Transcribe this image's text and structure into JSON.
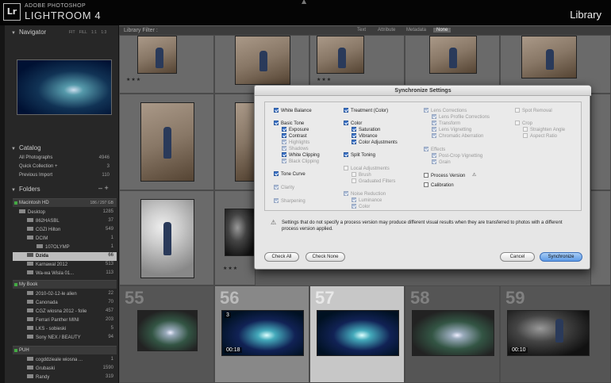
{
  "app": {
    "logo": "Lr",
    "brand_top": "ADOBE PHOTOSHOP",
    "brand_name": "LIGHTROOM 4",
    "module": "Library"
  },
  "left_panel": {
    "navigator": {
      "title": "Navigator",
      "options": "FIT FILL 1:1 1:3"
    },
    "catalog": {
      "title": "Catalog",
      "items": [
        {
          "label": "All Photographs",
          "count": "4946"
        },
        {
          "label": "Quick Collection +",
          "count": "3"
        },
        {
          "label": "Previous Import",
          "count": "110"
        }
      ]
    },
    "folders": {
      "title": "Folders",
      "controls": "– +",
      "drives": [
        {
          "label": "Macintosh HD",
          "info": "186 / 297 GB"
        },
        {
          "label": "My Book",
          "info": ""
        },
        {
          "label": "PUH",
          "info": ""
        }
      ],
      "mac_items": [
        {
          "label": "Desktop",
          "count": "1285"
        },
        {
          "label": "862HASBL",
          "count": "37"
        },
        {
          "label": "CGZI Hilton",
          "count": "549"
        },
        {
          "label": "DCIM",
          "count": "1"
        },
        {
          "label": "107OLYMP",
          "count": "1"
        },
        {
          "label": "Dzida",
          "count": "66"
        },
        {
          "label": "Karnawal 2012",
          "count": "513"
        },
        {
          "label": "Wa-wa Wisla 01...",
          "count": "113"
        }
      ],
      "mybook_items": [
        {
          "label": "2010-02-12-le alien",
          "count": "22"
        },
        {
          "label": "Canonada",
          "count": "70"
        },
        {
          "label": "CGZ wiosna 2012 - folie",
          "count": "457"
        },
        {
          "label": "Ferrari Panther MINI",
          "count": "203"
        },
        {
          "label": "LKS - sobieski",
          "count": "5"
        },
        {
          "label": "Sony NEX / BEAUTY",
          "count": "94"
        }
      ],
      "puh_items": [
        {
          "label": "cogddzieale wiosna ...",
          "count": "1"
        },
        {
          "label": "Grubaski",
          "count": "1590"
        },
        {
          "label": "Randy",
          "count": "319"
        }
      ]
    }
  },
  "filter_bar": {
    "label": "Library Filter :",
    "options": [
      "Text",
      "Attribute",
      "Metadata",
      "None"
    ]
  },
  "grid": {
    "stars": "★★★",
    "cell_numbers": [
      "55",
      "56",
      "57",
      "58",
      "59"
    ],
    "badges": {
      "time_a": "00:18",
      "time_b": "00:10",
      "mark": "3"
    }
  },
  "dialog": {
    "title": "Synchronize Settings",
    "col1": [
      {
        "label": "White Balance",
        "checked": true
      },
      {
        "label": "Basic Tone",
        "checked": true
      },
      {
        "label": "Exposure",
        "checked": true
      },
      {
        "label": "Contrast",
        "checked": true
      },
      {
        "label": "Highlights",
        "checked": true
      },
      {
        "label": "Shadows",
        "checked": true
      },
      {
        "label": "White Clipping",
        "checked": true
      },
      {
        "label": "Black Clipping",
        "checked": true
      },
      {
        "label": "Tone Curve",
        "checked": true
      },
      {
        "label": "Clarity",
        "checked": true
      },
      {
        "label": "Sharpening",
        "checked": true
      }
    ],
    "col2": [
      {
        "label": "Treatment (Color)",
        "checked": true
      },
      {
        "label": "Color",
        "checked": true
      },
      {
        "label": "Saturation",
        "checked": true
      },
      {
        "label": "Vibrance",
        "checked": true
      },
      {
        "label": "Color Adjustments",
        "checked": true
      },
      {
        "label": "Split Toning",
        "checked": true
      },
      {
        "label": "Local Adjustments",
        "checked": false
      },
      {
        "label": "Brush",
        "checked": false
      },
      {
        "label": "Graduated Filters",
        "checked": false
      },
      {
        "label": "Noise Reduction",
        "checked": true
      },
      {
        "label": "Luminance",
        "checked": true
      },
      {
        "label": "Color",
        "checked": true
      }
    ],
    "col3": [
      {
        "label": "Lens Corrections",
        "checked": true
      },
      {
        "label": "Lens Profile Corrections",
        "checked": true
      },
      {
        "label": "Transform",
        "checked": true
      },
      {
        "label": "Lens Vignetting",
        "checked": true
      },
      {
        "label": "Chromatic Aberration",
        "checked": true
      },
      {
        "label": "Effects",
        "checked": true
      },
      {
        "label": "Post-Crop Vignetting",
        "checked": true
      },
      {
        "label": "Grain",
        "checked": true
      },
      {
        "label": "Process Version",
        "checked": false
      },
      {
        "label": "Calibration",
        "checked": false
      }
    ],
    "col4": [
      {
        "label": "Spot Removal",
        "checked": false
      },
      {
        "label": "Crop",
        "checked": false
      },
      {
        "label": "Straighten Angle",
        "checked": false
      },
      {
        "label": "Aspect Ratio",
        "checked": false
      }
    ],
    "warning": "Settings that do not specify a process version may produce different visual results when they are transferred to photos with a different process version applied.",
    "buttons": {
      "check_all": "Check All",
      "check_none": "Check None",
      "cancel": "Cancel",
      "synchronize": "Synchronize"
    }
  }
}
